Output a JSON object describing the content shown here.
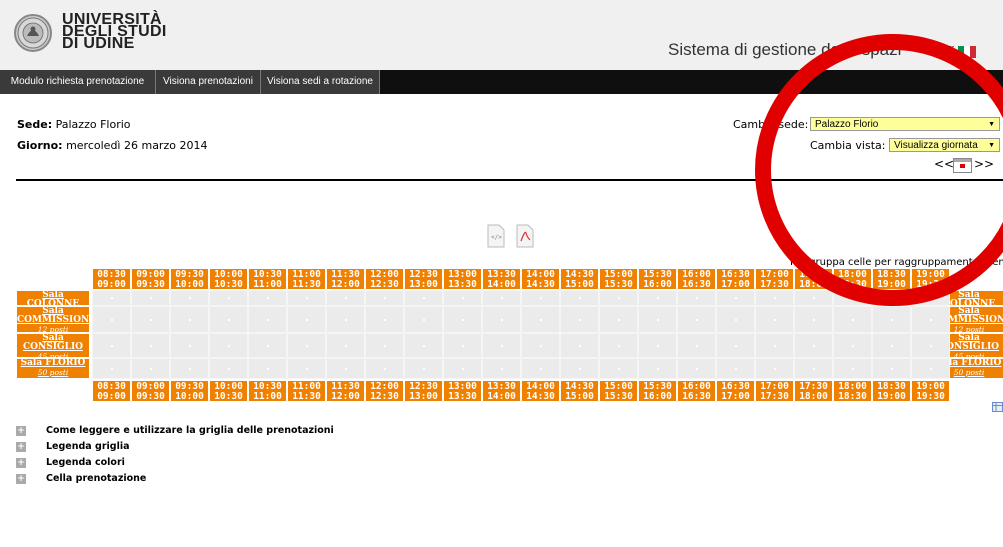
{
  "header": {
    "university": [
      "UNIVERSITÀ",
      "DEGLI STUDI",
      "DI UDINE"
    ],
    "system_title": "Sistema di gestione degli spazi",
    "flags": [
      "uk-flag-icon",
      "italy-flag-icon"
    ]
  },
  "nav": {
    "tabs": [
      "Modulo richiesta prenotazione",
      "Visiona prenotazioni",
      "Visiona sedi a rotazione"
    ]
  },
  "info": {
    "sede_label": "Sede:",
    "sede_value": "Palazzo Florio",
    "giorno_label": "Giorno:",
    "giorno_value": "mercoledì 26 marzo 2014",
    "cambia_sede_label": "Cambia sede:",
    "cambia_sede_value": "Palazzo Florio",
    "cambia_vista_label": "Cambia vista:",
    "cambia_vista_value": "Visualizza giornata",
    "prev": "<<",
    "next": ">>"
  },
  "grid": {
    "group_cells_label": "Raggruppa celle per raggruppamento prenotazione",
    "time_starts": [
      "08:30",
      "09:00",
      "09:30",
      "10:00",
      "10:30",
      "11:00",
      "11:30",
      "12:00",
      "12:30",
      "13:00",
      "13:30",
      "14:00",
      "14:30",
      "15:00",
      "15:30",
      "16:00",
      "16:30",
      "17:00",
      "17:30",
      "18:00",
      "18:30",
      "19:00"
    ],
    "time_ends": [
      "09:00",
      "09:30",
      "10:00",
      "10:30",
      "11:00",
      "11:30",
      "12:00",
      "12:30",
      "13:00",
      "13:30",
      "14:00",
      "14:30",
      "15:00",
      "15:30",
      "16:00",
      "16:30",
      "17:00",
      "17:30",
      "18:00",
      "18:30",
      "19:00",
      "19:30"
    ],
    "rooms": [
      {
        "name": "Sala COLONNE",
        "capacity": "20 posti"
      },
      {
        "name": "Sala COMMISSIONI",
        "capacity": "12 posti"
      },
      {
        "name": "Sala CONSIGLIO",
        "capacity": "45 posti"
      },
      {
        "name": "Sala FLORIO",
        "capacity": "50 posti"
      }
    ]
  },
  "legend": {
    "items": [
      "Come leggere e utilizzare la griglia delle prenotazioni",
      "Legenda griglia",
      "Legenda colori",
      "Cella prenotazione"
    ],
    "expand_symbol": "+"
  },
  "colors": {
    "accent": "#f08000",
    "nav_bg": "#0f0f0f",
    "select_bg": "#ffff99",
    "annotation_circle": "#e00000"
  }
}
